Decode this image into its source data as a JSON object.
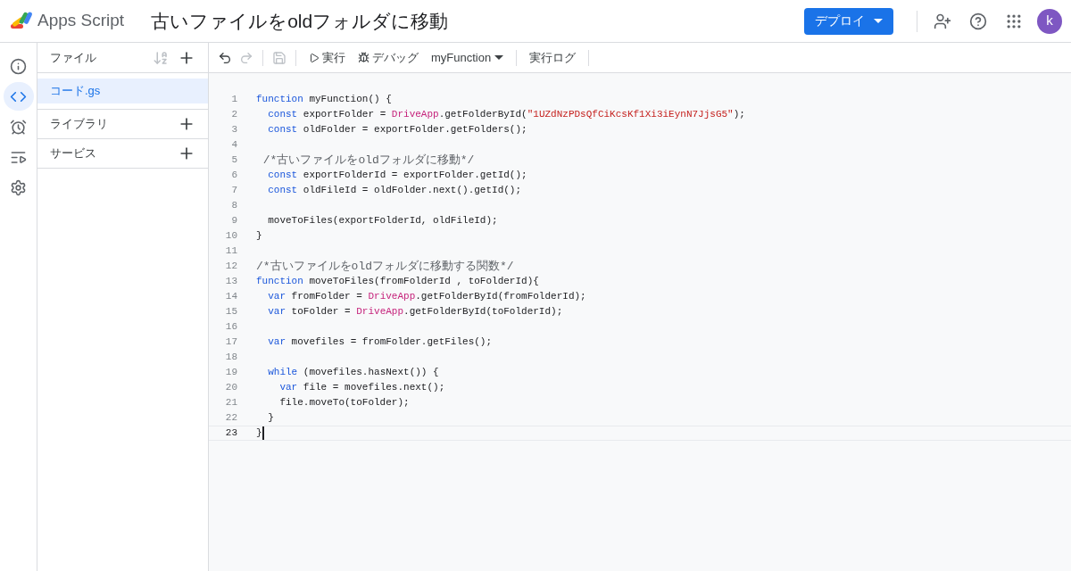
{
  "header": {
    "app_name": "Apps Script",
    "project_title": "古いファイルをoldフォルダに移動",
    "deploy_button": "デプロイ",
    "avatar": "k"
  },
  "rail": [
    {
      "kind": "info",
      "selected": false
    },
    {
      "kind": "code",
      "selected": true
    },
    {
      "kind": "triggers",
      "selected": false
    },
    {
      "kind": "executions",
      "selected": false
    },
    {
      "kind": "settings",
      "selected": false
    }
  ],
  "files": {
    "title": "ファイル",
    "items": [
      {
        "name": "コード.gs",
        "selected": true
      }
    ],
    "sections": [
      {
        "title": "ライブラリ"
      },
      {
        "title": "サービス"
      }
    ]
  },
  "toolbar": {
    "undo_disabled": false,
    "redo_disabled": true,
    "save_disabled": true,
    "run": "実行",
    "debug": "デバッグ",
    "function_select": "myFunction",
    "log": "実行ログ"
  },
  "editor": {
    "lines": [
      {
        "number": "1",
        "selected": false,
        "tokens": [
          {
            "kind": "keyword",
            "text": "function"
          },
          {
            "kind": "plain",
            "text": " myFunction() {"
          }
        ]
      },
      {
        "number": "2",
        "selected": false,
        "tokens": [
          {
            "kind": "keyword",
            "text": "  const"
          },
          {
            "kind": "plain",
            "text": " exportFolder = "
          },
          {
            "kind": "builtin",
            "text": "DriveApp"
          },
          {
            "kind": "plain",
            "text": ".getFolderById("
          },
          {
            "kind": "string",
            "text": "\"1UZdNzPDsQfCiKcsKf1Xi3iEynN7JjsG5\""
          },
          {
            "kind": "plain",
            "text": ");"
          }
        ]
      },
      {
        "number": "3",
        "selected": false,
        "tokens": [
          {
            "kind": "keyword",
            "text": "  const"
          },
          {
            "kind": "plain",
            "text": " oldFolder = exportFolder.getFolders();"
          }
        ]
      },
      {
        "number": "4",
        "selected": false
      },
      {
        "number": "5",
        "selected": false,
        "tokens": [
          {
            "kind": "comment",
            "text": " /*古いファイルをoldフォルダに移動*/"
          }
        ]
      },
      {
        "number": "6",
        "selected": false,
        "tokens": [
          {
            "kind": "keyword",
            "text": "  const"
          },
          {
            "kind": "plain",
            "text": " exportFolderId = exportFolder.getId();"
          }
        ]
      },
      {
        "number": "7",
        "selected": false,
        "tokens": [
          {
            "kind": "keyword",
            "text": "  const"
          },
          {
            "kind": "plain",
            "text": " oldFileId = oldFolder.next().getId();"
          }
        ]
      },
      {
        "number": "8",
        "selected": false
      },
      {
        "number": "9",
        "selected": false,
        "tokens": [
          {
            "kind": "plain",
            "text": "  moveToFiles(exportFolderId, oldFileId);"
          }
        ]
      },
      {
        "number": "10",
        "selected": false,
        "tokens": [
          {
            "kind": "plain",
            "text": "}"
          }
        ]
      },
      {
        "number": "11",
        "selected": false
      },
      {
        "number": "12",
        "selected": false,
        "tokens": [
          {
            "kind": "comment",
            "text": "/*古いファイルをoldフォルダに移動する関数*/"
          }
        ]
      },
      {
        "number": "13",
        "selected": false,
        "tokens": [
          {
            "kind": "keyword",
            "text": "function"
          },
          {
            "kind": "plain",
            "text": " moveToFiles(fromFolderId , toFolderId){"
          }
        ]
      },
      {
        "number": "14",
        "selected": false,
        "tokens": [
          {
            "kind": "keyword",
            "text": "  var"
          },
          {
            "kind": "plain",
            "text": " fromFolder = "
          },
          {
            "kind": "builtin",
            "text": "DriveApp"
          },
          {
            "kind": "plain",
            "text": ".getFolderById(fromFolderId);"
          }
        ]
      },
      {
        "number": "15",
        "selected": false,
        "tokens": [
          {
            "kind": "keyword",
            "text": "  var"
          },
          {
            "kind": "plain",
            "text": " toFolder = "
          },
          {
            "kind": "builtin",
            "text": "DriveApp"
          },
          {
            "kind": "plain",
            "text": ".getFolderById(toFolderId);"
          }
        ]
      },
      {
        "number": "16",
        "selected": false
      },
      {
        "number": "17",
        "selected": false,
        "tokens": [
          {
            "kind": "keyword",
            "text": "  var"
          },
          {
            "kind": "plain",
            "text": " movefiles = fromFolder.getFiles();"
          }
        ]
      },
      {
        "number": "18",
        "selected": false
      },
      {
        "number": "19",
        "selected": false,
        "tokens": [
          {
            "kind": "keyword",
            "text": "  while"
          },
          {
            "kind": "plain",
            "text": " (movefiles.hasNext()) {"
          }
        ]
      },
      {
        "number": "20",
        "selected": false,
        "tokens": [
          {
            "kind": "keyword",
            "text": "    var"
          },
          {
            "kind": "plain",
            "text": " file = movefiles.next();"
          }
        ]
      },
      {
        "number": "21",
        "selected": false,
        "tokens": [
          {
            "kind": "plain",
            "text": "    file.moveTo(toFolder);"
          }
        ]
      },
      {
        "number": "22",
        "selected": false,
        "tokens": [
          {
            "kind": "plain",
            "text": "  }"
          }
        ]
      },
      {
        "number": "23",
        "selected": true,
        "tokens": [
          {
            "kind": "plain",
            "text": "}"
          }
        ]
      }
    ]
  }
}
